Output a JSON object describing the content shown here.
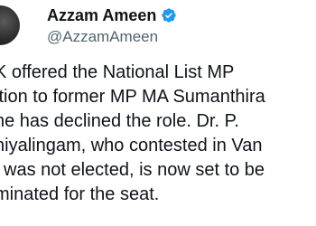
{
  "author": {
    "display_name": "Azzam Ameen",
    "handle": "@AzzamAmeen",
    "verified": true,
    "verified_color": "#1d9bf0"
  },
  "tweet": {
    "lines": [
      "K offered the National List MP",
      "ition to former MP MA Sumanthira",
      " he has declined the role. Dr. P.",
      "hiyalingam, who contested in Van",
      "l was not elected, is now set to be",
      "minated for the seat."
    ]
  }
}
